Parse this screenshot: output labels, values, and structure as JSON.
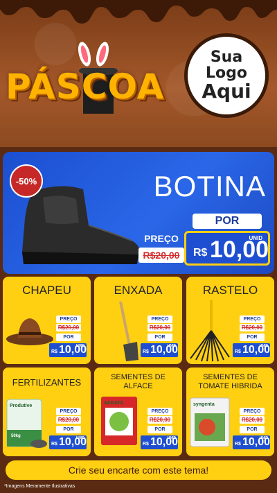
{
  "header": {
    "title": "PÁSCOA",
    "logo_line1": "Sua Logo",
    "logo_line2": "Aqui"
  },
  "featured": {
    "discount": "-50%",
    "name": "BOTINA",
    "preco_label": "PREÇO",
    "old_price": "R$20,00",
    "por_label": "POR",
    "unid_label": "UNID",
    "currency": "R$",
    "new_price": "10,00"
  },
  "products": [
    {
      "name": "CHAPEU",
      "preco_label": "PREÇO",
      "old_price": "R$20,00",
      "por_label": "POR",
      "unid_label": "UNID",
      "currency": "R$",
      "new_price": "10,00"
    },
    {
      "name": "ENXADA",
      "preco_label": "PREÇO",
      "old_price": "R$20,00",
      "por_label": "POR",
      "unid_label": "UNID",
      "currency": "R$",
      "new_price": "10,00"
    },
    {
      "name": "RASTELO",
      "preco_label": "PREÇO",
      "old_price": "R$20,00",
      "por_label": "POR",
      "unid_label": "UNID",
      "currency": "R$",
      "new_price": "10,00"
    },
    {
      "name": "FERTILIZANTES",
      "preco_label": "PREÇO",
      "old_price": "R$20,00",
      "por_label": "POR",
      "unid_label": "UNID",
      "currency": "R$",
      "new_price": "10,00",
      "package_brand": "Produtive",
      "package_weight": "50kg"
    },
    {
      "name": "SEMENTES DE ALFACE",
      "preco_label": "PREÇO",
      "old_price": "R$20,00",
      "por_label": "POR",
      "unid_label": "UNID",
      "currency": "R$",
      "new_price": "10,00",
      "package_brand": "SAKATA"
    },
    {
      "name": "SEMENTES DE TOMATE HIBRIDA",
      "preco_label": "PREÇO",
      "old_price": "R$20,00",
      "por_label": "POR",
      "unid_label": "UNID",
      "currency": "R$",
      "new_price": "10,00",
      "package_brand": "syngenta"
    }
  ],
  "footer": {
    "cta": "Crie seu encarte com este tema!",
    "disclaimer": "*Imagens Meramente Ilustrativas"
  }
}
